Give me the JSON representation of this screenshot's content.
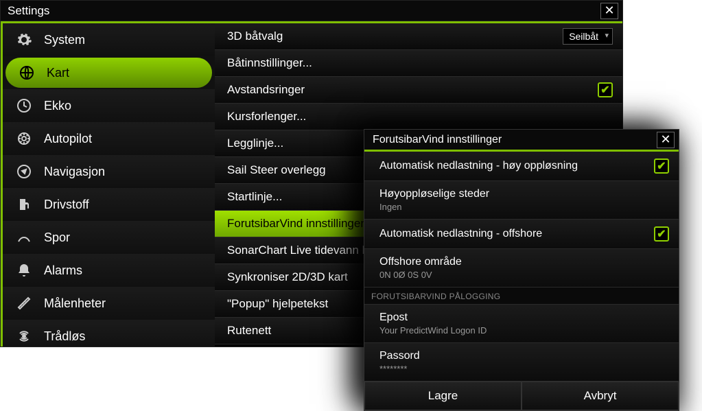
{
  "window": {
    "title": "Settings"
  },
  "sidebar": {
    "items": [
      {
        "label": "System"
      },
      {
        "label": "Kart"
      },
      {
        "label": "Ekko"
      },
      {
        "label": "Autopilot"
      },
      {
        "label": "Navigasjon"
      },
      {
        "label": "Drivstoff"
      },
      {
        "label": "Spor"
      },
      {
        "label": "Alarms"
      },
      {
        "label": "Målenheter"
      },
      {
        "label": "Trådløs"
      }
    ]
  },
  "content": {
    "rows": [
      {
        "label": "3D båtvalg",
        "select": "Seilbåt"
      },
      {
        "label": "Båtinnstillinger..."
      },
      {
        "label": "Avstandsringer"
      },
      {
        "label": "Kursforlenger..."
      },
      {
        "label": "Legglinje..."
      },
      {
        "label": "Sail Steer overlegg"
      },
      {
        "label": "Startlinje..."
      },
      {
        "label": "ForutsibarVind innstillinger"
      },
      {
        "label": "SonarChart Live tidevann ko"
      },
      {
        "label": "Synkroniser 2D/3D kart"
      },
      {
        "label": "\"Popup\" hjelpetekst"
      },
      {
        "label": "Rutenett"
      }
    ]
  },
  "modal": {
    "title": "ForutsibarVind innstillinger",
    "rows": {
      "autoHigh": "Automatisk nedlastning - høy oppløsning",
      "highResPlacesLabel": "Høyoppløselige steder",
      "highResPlacesValue": "Ingen",
      "autoOffshore": "Automatisk nedlastning - offshore",
      "offshoreAreaLabel": "Offshore område",
      "offshoreAreaValue": "0N 0Ø 0S 0V",
      "sectionHeader": "FORUTSIBARVIND PÅLOGGING",
      "emailLabel": "Epost",
      "emailValue": "Your PredictWind Logon ID",
      "passwordLabel": "Passord",
      "passwordValue": "********"
    },
    "buttons": {
      "save": "Lagre",
      "cancel": "Avbryt"
    }
  }
}
